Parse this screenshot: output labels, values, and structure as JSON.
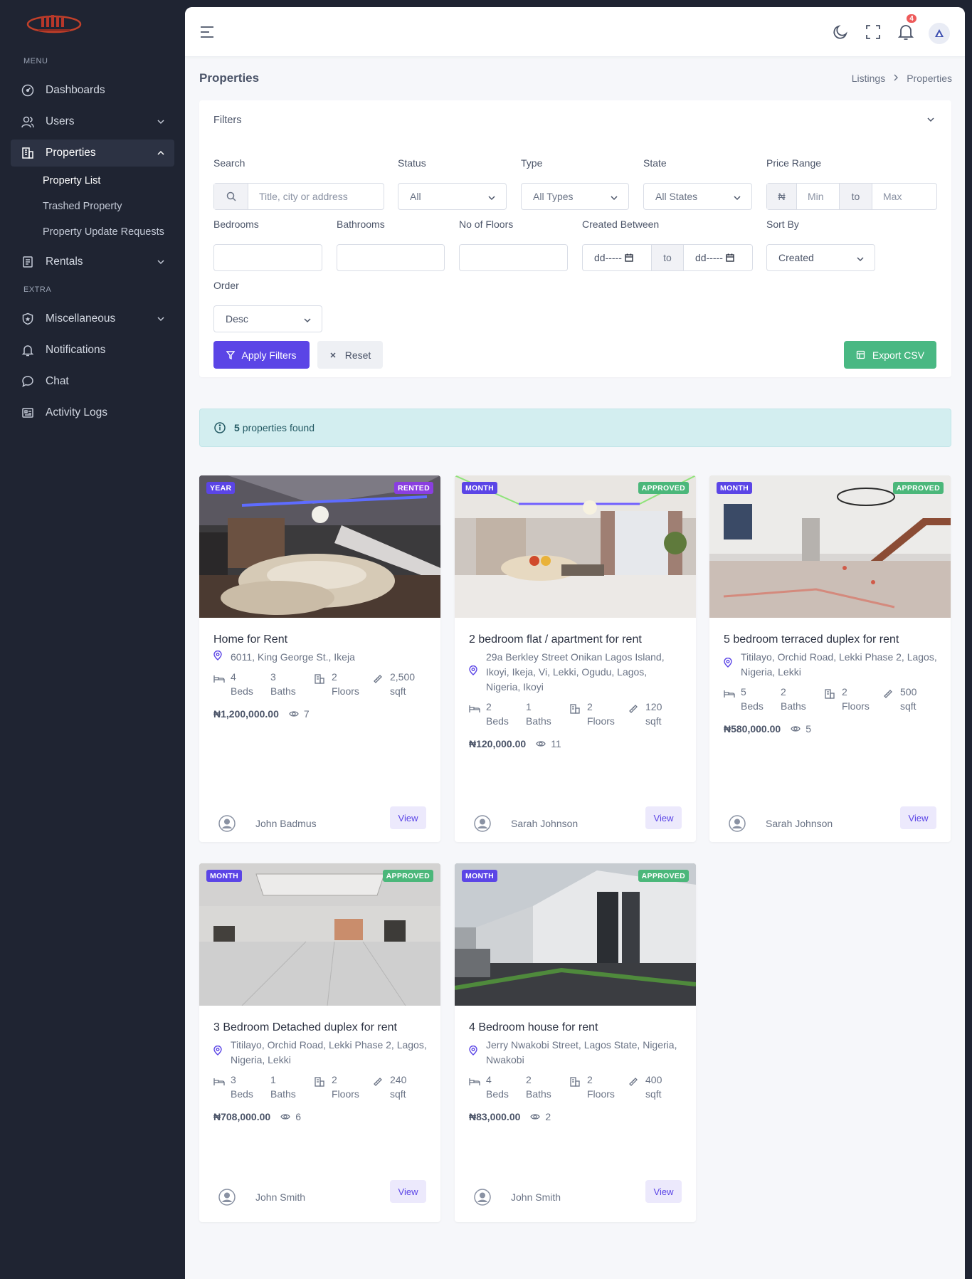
{
  "sidebar": {
    "menu_title": "MENU",
    "extra_title": "EXTRA",
    "items": [
      {
        "label": "Dashboards",
        "icon": "gauge-icon"
      },
      {
        "label": "Users",
        "icon": "users-icon"
      },
      {
        "label": "Properties",
        "icon": "building-icon"
      },
      {
        "label": "Rentals",
        "icon": "document-icon"
      },
      {
        "label": "Miscellaneous",
        "icon": "shield-icon"
      },
      {
        "label": "Notifications",
        "icon": "bell-icon"
      },
      {
        "label": "Chat",
        "icon": "chat-icon"
      },
      {
        "label": "Activity Logs",
        "icon": "log-icon"
      }
    ],
    "sub_items": [
      "Property List",
      "Trashed Property",
      "Property Update Requests"
    ]
  },
  "topbar": {
    "notification_count": "4"
  },
  "page": {
    "title": "Properties",
    "breadcrumb": [
      "Listings",
      "Properties"
    ]
  },
  "filters": {
    "heading": "Filters",
    "search_label": "Search",
    "search_placeholder": "Title, city or address",
    "status_label": "Status",
    "status_value": "All",
    "type_label": "Type",
    "type_value": "All Types",
    "state_label": "State",
    "state_value": "All States",
    "price_label": "Price Range",
    "currency": "₦",
    "min_placeholder": "Min",
    "to_text": "to",
    "max_placeholder": "Max",
    "bedrooms_label": "Bedrooms",
    "bathrooms_label": "Bathrooms",
    "floors_label": "No of Floors",
    "created_label": "Created Between",
    "date_placeholder": "dd-----",
    "sort_label": "Sort By",
    "sort_value": "Created",
    "order_label": "Order",
    "order_value": "Desc",
    "apply_label": "Apply Filters",
    "reset_label": "Reset",
    "export_label": "Export CSV"
  },
  "result": {
    "count": "5",
    "text": "properties found"
  },
  "colors": {
    "accent": "#5b45e6",
    "success": "#49b883",
    "sidebar": "#1f2432",
    "rented": "#8a3ee0",
    "approved": "#4bb77a"
  },
  "properties": [
    {
      "period": "YEAR",
      "status": "RENTED",
      "title": "Home for Rent",
      "address": "6011, King George St., Ikeja",
      "beds": "4",
      "beds_unit": "Beds",
      "baths": "3",
      "baths_unit": "Baths",
      "floors": "2",
      "floors_unit": "Floors",
      "area": "2,500",
      "area_unit": "sqft",
      "price": "₦1,200,000.00",
      "views": "7",
      "owner": "John Badmus",
      "view_label": "View"
    },
    {
      "period": "MONTH",
      "status": "APPROVED",
      "title": "2 bedroom flat / apartment for rent",
      "address": "29a Berkley Street Onikan Lagos Island, Ikoyi, Ikeja, Vi, Lekki, Ogudu, Lagos, Nigeria, Ikoyi",
      "beds": "2",
      "beds_unit": "Beds",
      "baths": "1",
      "baths_unit": "Baths",
      "floors": "2",
      "floors_unit": "Floors",
      "area": "120",
      "area_unit": "sqft",
      "price": "₦120,000.00",
      "views": "11",
      "owner": "Sarah Johnson",
      "view_label": "View"
    },
    {
      "period": "MONTH",
      "status": "APPROVED",
      "title": "5 bedroom terraced duplex for rent",
      "address": "Titilayo, Orchid Road, Lekki Phase 2, Lagos, Nigeria, Lekki",
      "beds": "5",
      "beds_unit": "Beds",
      "baths": "2",
      "baths_unit": "Baths",
      "floors": "2",
      "floors_unit": "Floors",
      "area": "500",
      "area_unit": "sqft",
      "price": "₦580,000.00",
      "views": "5",
      "owner": "Sarah Johnson",
      "view_label": "View"
    },
    {
      "period": "MONTH",
      "status": "APPROVED",
      "title": "3 Bedroom Detached duplex for rent",
      "address": "Titilayo, Orchid Road, Lekki Phase 2, Lagos, Nigeria, Lekki",
      "beds": "3",
      "beds_unit": "Beds",
      "baths": "1",
      "baths_unit": "Baths",
      "floors": "2",
      "floors_unit": "Floors",
      "area": "240",
      "area_unit": "sqft",
      "price": "₦708,000.00",
      "views": "6",
      "owner": "John Smith",
      "view_label": "View"
    },
    {
      "period": "MONTH",
      "status": "APPROVED",
      "title": "4 Bedroom house for rent",
      "address": "Jerry Nwakobi Street, Lagos State, Nigeria, Nwakobi",
      "beds": "4",
      "beds_unit": "Beds",
      "baths": "2",
      "baths_unit": "Baths",
      "floors": "2",
      "floors_unit": "Floors",
      "area": "400",
      "area_unit": "sqft",
      "price": "₦83,000.00",
      "views": "2",
      "owner": "John Smith",
      "view_label": "View"
    }
  ]
}
